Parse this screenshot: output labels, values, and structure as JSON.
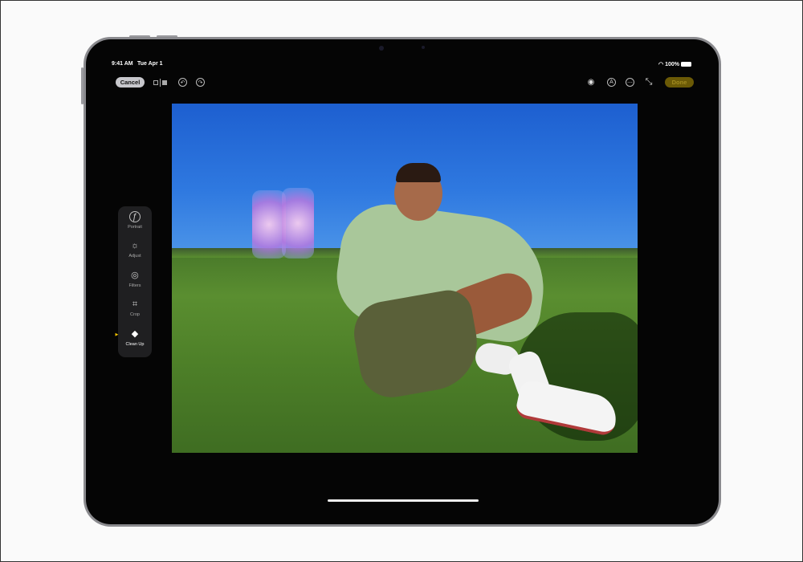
{
  "status": {
    "time": "9:41 AM",
    "date": "Tue Apr 1",
    "battery": "100%"
  },
  "toolbar": {
    "cancel": "Cancel",
    "done": "Done",
    "undo_icon": "↶",
    "redo_icon": "↷",
    "markup_icon": "A",
    "more_icon": "⋯",
    "expand_icon": "⤡",
    "hide_icon": "◉"
  },
  "tools": [
    {
      "label": "Portrait",
      "icon": "ƒ"
    },
    {
      "label": "Adjust",
      "icon": "☼"
    },
    {
      "label": "Filters",
      "icon": "◎"
    },
    {
      "label": "Crop",
      "icon": "⌗"
    },
    {
      "label": "Clean Up",
      "icon": "◆",
      "active": true
    }
  ]
}
